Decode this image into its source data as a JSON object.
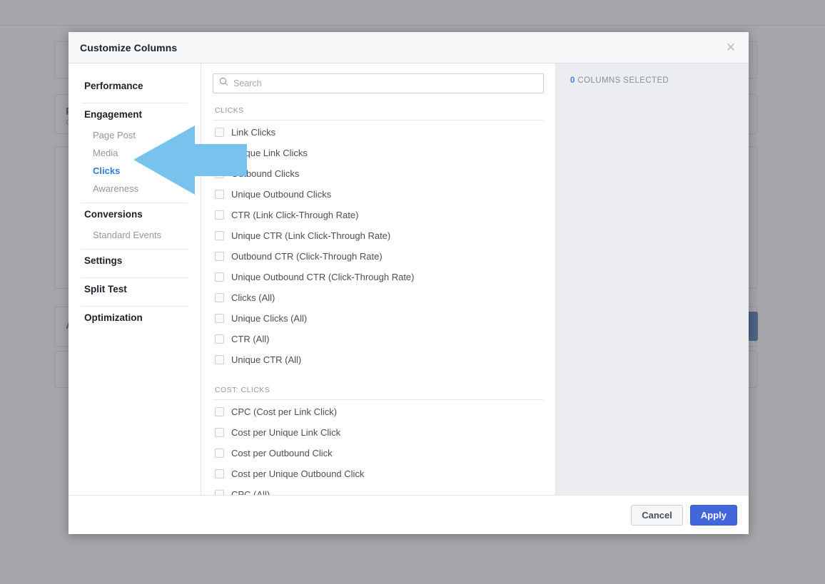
{
  "modal": {
    "title": "Customize Columns",
    "close_icon": "close-icon"
  },
  "sidebar": {
    "groups": [
      {
        "label": "Performance",
        "items": []
      },
      {
        "label": "Engagement",
        "items": [
          {
            "label": "Page Post",
            "active": false
          },
          {
            "label": "Media",
            "active": false
          },
          {
            "label": "Clicks",
            "active": true
          },
          {
            "label": "Awareness",
            "active": false
          }
        ]
      },
      {
        "label": "Conversions",
        "items": [
          {
            "label": "Standard Events",
            "active": false
          }
        ]
      },
      {
        "label": "Settings",
        "items": []
      },
      {
        "label": "Split Test",
        "items": []
      },
      {
        "label": "Optimization",
        "items": []
      }
    ]
  },
  "search": {
    "icon": "search-icon",
    "placeholder": "Search",
    "value": ""
  },
  "sections": [
    {
      "heading": "CLICKS",
      "options": [
        {
          "label": "Link Clicks",
          "checked": false
        },
        {
          "label": "Unique Link Clicks",
          "checked": false
        },
        {
          "label": "Outbound Clicks",
          "checked": false
        },
        {
          "label": "Unique Outbound Clicks",
          "checked": false
        },
        {
          "label": "CTR (Link Click-Through Rate)",
          "checked": false
        },
        {
          "label": "Unique CTR (Link Click-Through Rate)",
          "checked": false
        },
        {
          "label": "Outbound CTR (Click-Through Rate)",
          "checked": false
        },
        {
          "label": "Unique Outbound CTR (Click-Through Rate)",
          "checked": false
        },
        {
          "label": "Clicks (All)",
          "checked": false
        },
        {
          "label": "Unique Clicks (All)",
          "checked": false
        },
        {
          "label": "CTR (All)",
          "checked": false
        },
        {
          "label": "Unique CTR (All)",
          "checked": false
        }
      ]
    },
    {
      "heading": "COST: CLICKS",
      "options": [
        {
          "label": "CPC (Cost per Link Click)",
          "checked": false
        },
        {
          "label": "Cost per Unique Link Click",
          "checked": false
        },
        {
          "label": "Cost per Outbound Click",
          "checked": false
        },
        {
          "label": "Cost per Unique Outbound Click",
          "checked": false
        },
        {
          "label": "CPC (All)",
          "checked": false
        }
      ]
    }
  ],
  "right_panel": {
    "count": "0",
    "count_label": "COLUMNS SELECTED"
  },
  "footer": {
    "cancel_label": "Cancel",
    "apply_label": "Apply"
  },
  "annotation": {
    "arrow_icon": "left-arrow-annotation",
    "color": "#78c3ee"
  },
  "background": {
    "partial_text": "A",
    "accent_color": "#2b7fd4",
    "button_color": "#1d4fa0"
  }
}
